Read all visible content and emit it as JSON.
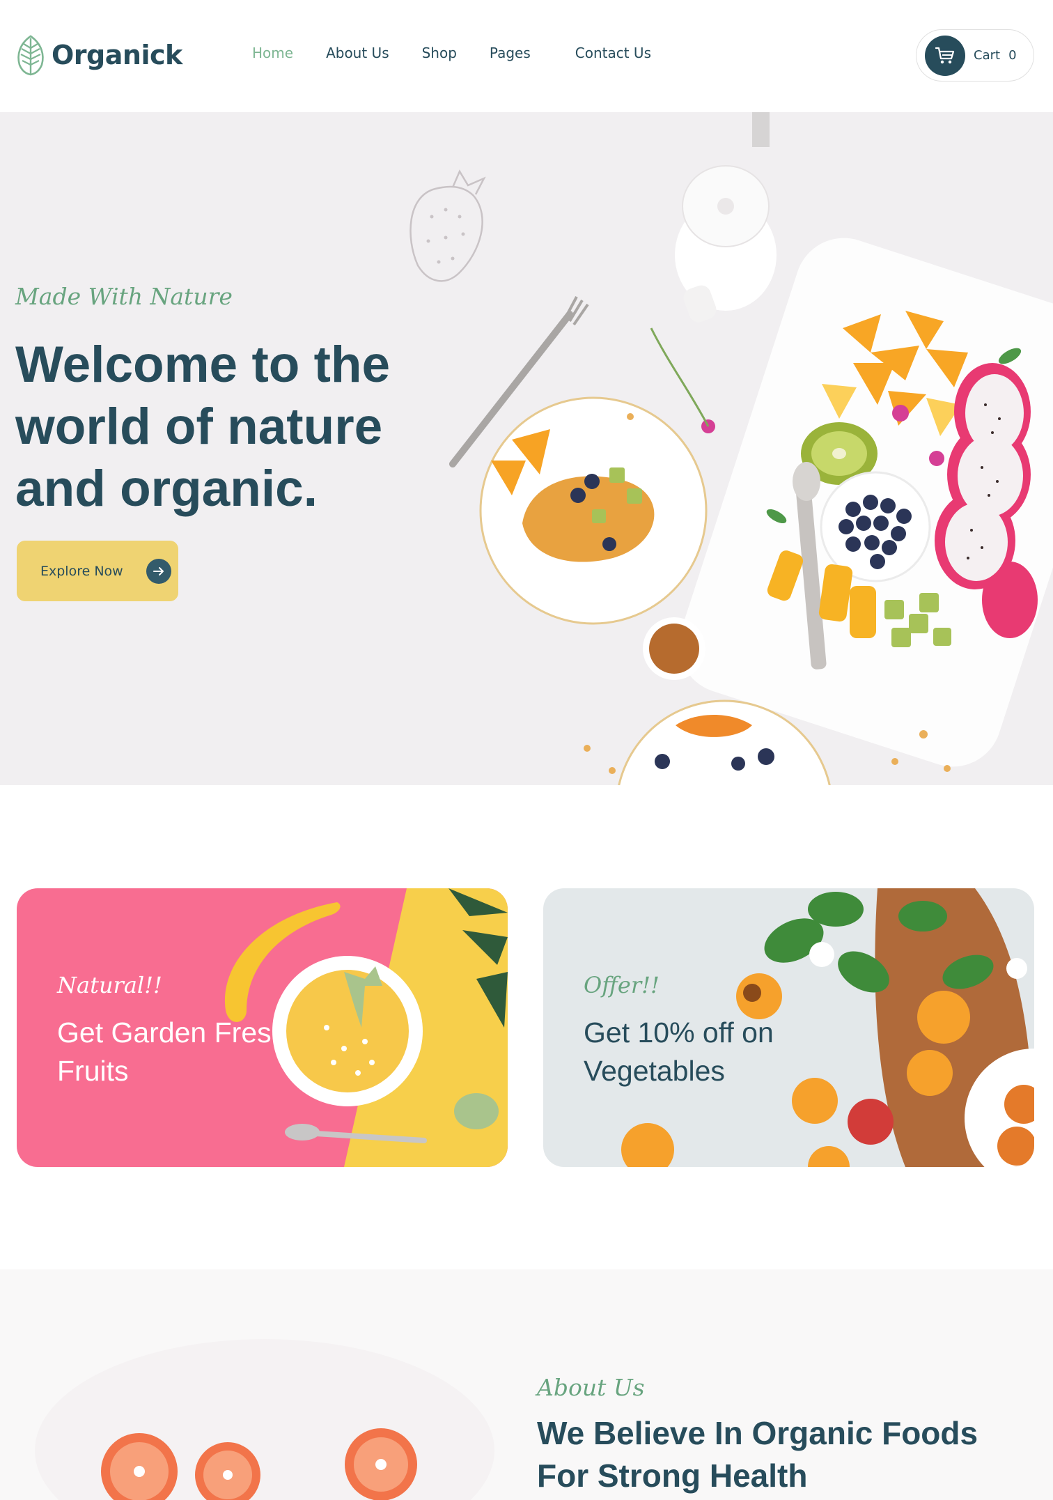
{
  "brand": {
    "name": "Organick",
    "logo_icon": "leaf-icon"
  },
  "nav": {
    "items": [
      {
        "label": "Home",
        "active": true
      },
      {
        "label": "About Us",
        "active": false
      },
      {
        "label": "Shop",
        "active": false
      },
      {
        "label": "Pages",
        "active": false
      },
      {
        "label": "Contact Us",
        "active": false
      }
    ]
  },
  "cart": {
    "label": "Cart",
    "count": "0",
    "icon": "cart-icon"
  },
  "hero": {
    "tagline": "Made With Nature",
    "title": "Welcome to the world of nature and organic.",
    "button_label": "Explore Now",
    "button_icon": "arrow-right-icon"
  },
  "offers": [
    {
      "tag": "Natural!!",
      "title": "Get Garden Fresh Fruits"
    },
    {
      "tag": "Offer!!",
      "title": "Get 10% off on Vegetables"
    }
  ],
  "about": {
    "tag": "About Us",
    "title": "We Believe In Organic Foods For Strong Health"
  },
  "colors": {
    "primary": "#274c5b",
    "accent_green": "#7eb693",
    "button_yellow": "#efd372",
    "offer_pink": "#f86d91",
    "hero_bg": "#f1eff1"
  }
}
